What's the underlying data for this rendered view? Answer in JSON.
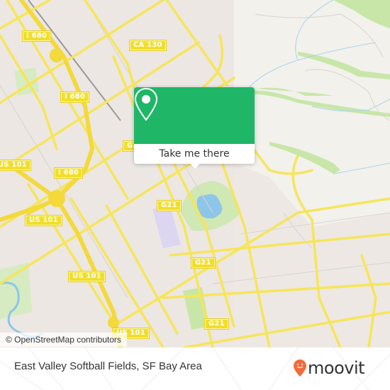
{
  "map": {
    "attribution": "© OpenStreetMap contributors",
    "road_labels": [
      {
        "id": "i680-top",
        "text": "I 680"
      },
      {
        "id": "ca130",
        "text": "CA 130"
      },
      {
        "id": "i680-mid",
        "text": "I 680"
      },
      {
        "id": "us101-left",
        "text": "US 101"
      },
      {
        "id": "i680-low",
        "text": "I 680"
      },
      {
        "id": "g21-upper",
        "text": "G21"
      },
      {
        "id": "us101-mid-left",
        "text": "US 101"
      },
      {
        "id": "g21-center",
        "text": "G21"
      },
      {
        "id": "us101-bottom-left",
        "text": "US 101"
      },
      {
        "id": "g21-mid",
        "text": "G21"
      },
      {
        "id": "us101-bottom",
        "text": "US 101"
      },
      {
        "id": "g21-bottom",
        "text": "G21"
      }
    ],
    "colors": {
      "land": "#f2efe9",
      "major_road": "#f6e55a",
      "water": "#8dc6e8",
      "park": "#c8e6a8",
      "accent_green": "#1fb767"
    }
  },
  "popup": {
    "icon": "map-pin-icon",
    "action_label": "Take me there"
  },
  "footer": {
    "location_title": "East Valley Softball Fields, SF Bay Area",
    "brand": "moovit",
    "brand_color": "#f26a3b"
  }
}
